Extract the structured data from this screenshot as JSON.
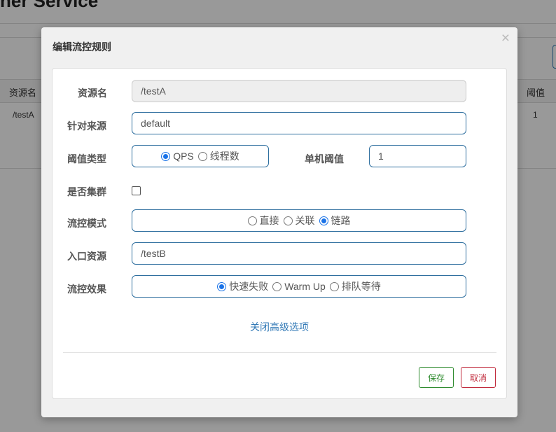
{
  "background": {
    "page_title": "ner Service",
    "table": {
      "col_resource": "资源名",
      "col_threshold": "阈值",
      "row_resource": "/testA",
      "row_threshold": "1"
    }
  },
  "modal": {
    "title": "编辑流控规则",
    "close_symbol": "×",
    "resource_name": {
      "label": "资源名",
      "value": "/testA"
    },
    "limit_app": {
      "label": "针对来源",
      "value": "default"
    },
    "threshold_type": {
      "label": "阈值类型",
      "options": [
        "QPS",
        "线程数"
      ],
      "selected": 0
    },
    "single_threshold": {
      "label": "单机阈值",
      "value": "1"
    },
    "cluster": {
      "label": "是否集群",
      "checked": false
    },
    "flow_mode": {
      "label": "流控模式",
      "options": [
        "直接",
        "关联",
        "链路"
      ],
      "selected": 2
    },
    "entry_resource": {
      "label": "入口资源",
      "value": "/testB"
    },
    "flow_effect": {
      "label": "流控效果",
      "options": [
        "快速失败",
        "Warm Up",
        "排队等待"
      ],
      "selected": 0
    },
    "advanced_link": "关闭高级选项",
    "save_label": "保存",
    "cancel_label": "取消"
  },
  "colors": {
    "accent": "#337ab7",
    "radio_checked": "#1a73e8",
    "save": "#2e8b2e",
    "cancel": "#c0293b"
  }
}
